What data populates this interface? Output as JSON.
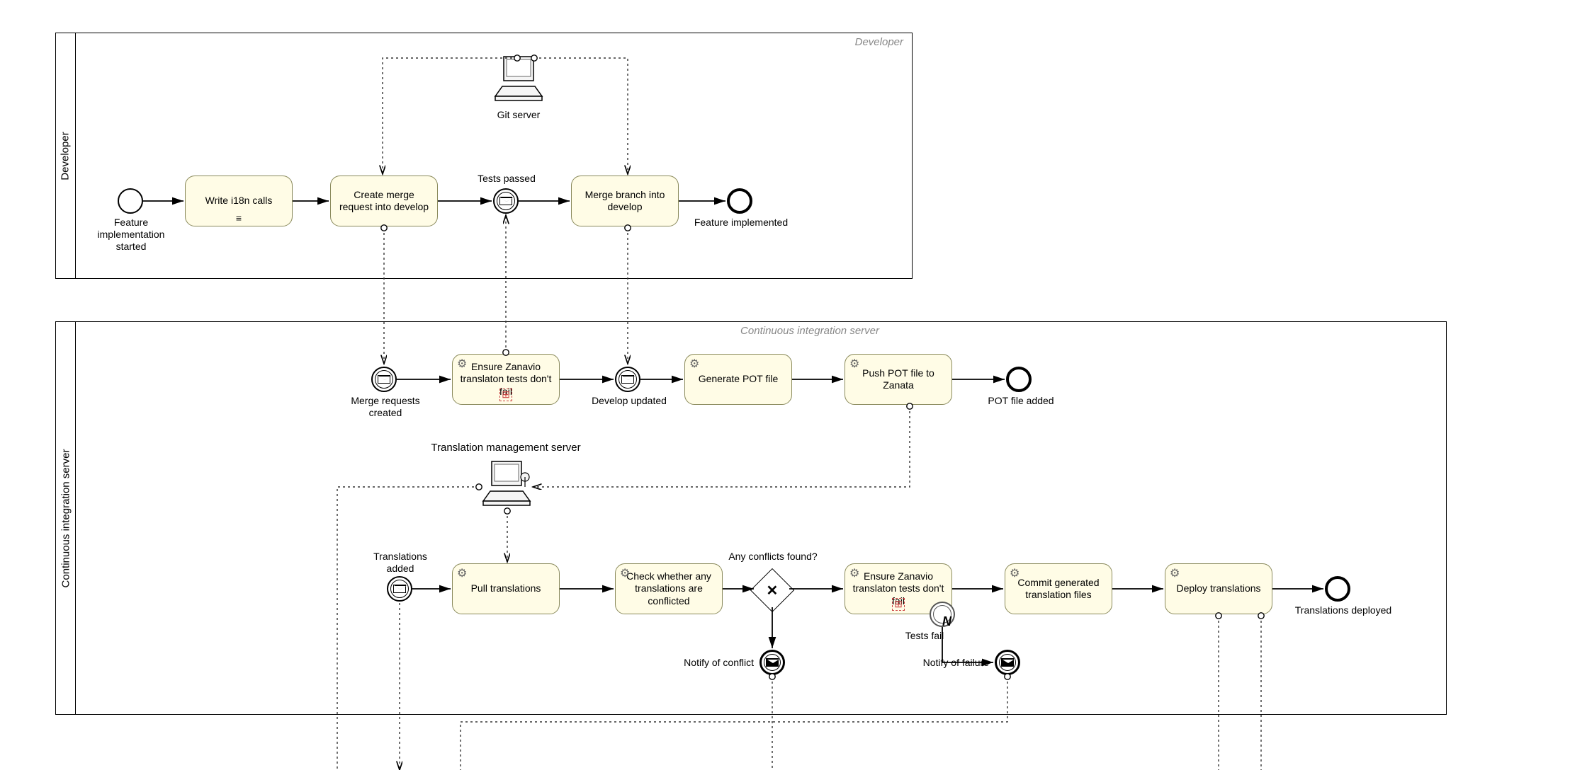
{
  "pools": {
    "developer": {
      "label": "Developer",
      "participant": "Developer"
    },
    "ci": {
      "label": "Continuous integration server",
      "participant": "Continuous integration server"
    }
  },
  "datastores": {
    "git": "Git server",
    "tms": "Translation management server"
  },
  "events": {
    "feature_start": "Feature\nimplementation\nstarted",
    "tests_passed": "Tests passed",
    "feature_implemented": "Feature implemented",
    "mr_created": "Merge requests\ncreated",
    "develop_updated": "Develop updated",
    "pot_added": "POT file added",
    "translations_added": "Translations\nadded",
    "translations_deployed": "Translations deployed",
    "tests_fail": "Tests fail",
    "notify_conflict": "Notify of conflict",
    "notify_failure": "Notify of failure"
  },
  "tasks": {
    "write_i18n": "Write i18n calls",
    "create_mr": "Create merge request into develop",
    "merge_branch": "Merge branch into develop",
    "ensure_tests_1": "Ensure Zanavio translaton tests don't fail",
    "generate_pot": "Generate POT file",
    "push_pot": "Push POT file to Zanata",
    "pull_translations": "Pull translations",
    "check_conflicted": "Check whether any translations are conflicted",
    "ensure_tests_2": "Ensure Zanavio translaton tests don't fail",
    "commit_files": "Commit generated translation files",
    "deploy": "Deploy translations"
  },
  "gateways": {
    "conflicts": "Any conflicts found?"
  }
}
